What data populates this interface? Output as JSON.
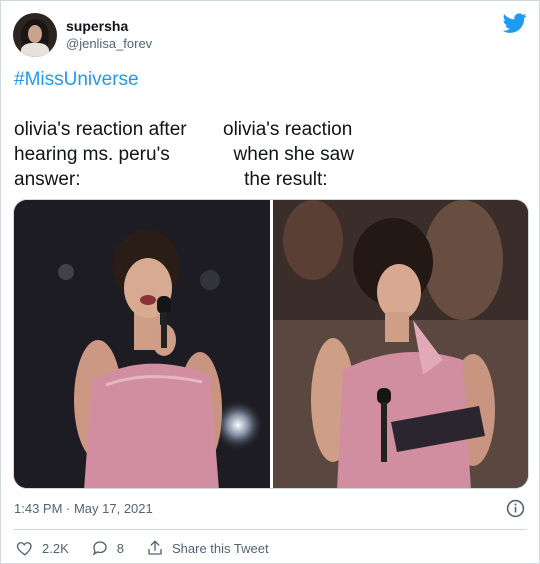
{
  "tweet": {
    "display_name": "supersha",
    "handle": "@jenlisa_forev",
    "hashtag": "#MissUniverse",
    "caption_left": "olivia's reaction after\nhearing ms. peru's\nanswer:",
    "caption_right": "olivia's reaction\n  when she saw\n    the result:",
    "timestamp": "1:43 PM · May 17, 2021"
  },
  "actions": {
    "likes": "2.2K",
    "replies": "8",
    "share_label": "Share this Tweet"
  },
  "colors": {
    "accent": "#1d9bf0",
    "secondary_text": "#536471"
  },
  "icons": [
    "twitter-bird-icon",
    "info-icon",
    "heart-icon",
    "reply-icon",
    "share-icon"
  ]
}
